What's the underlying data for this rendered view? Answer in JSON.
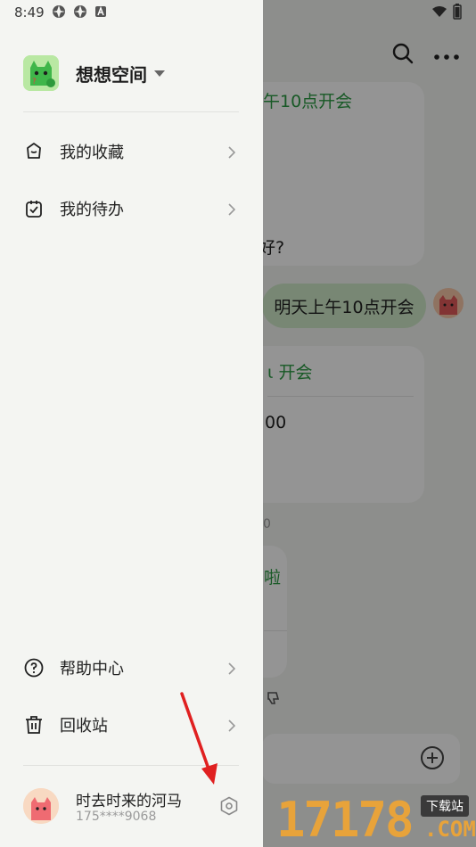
{
  "status_bar": {
    "time": "8:49"
  },
  "drawer": {
    "space_name": "想想空间",
    "menu_top": [
      {
        "label": "我的收藏",
        "icon": "star-icon"
      },
      {
        "label": "我的待办",
        "icon": "todo-icon"
      }
    ],
    "menu_bottom": [
      {
        "label": "帮助中心",
        "icon": "help-icon"
      },
      {
        "label": "回收站",
        "icon": "trash-icon"
      }
    ],
    "user": {
      "name": "时去时来的河马",
      "phone": "175****9068"
    }
  },
  "background_chat": {
    "card1_green": "午10点开会",
    "card1_dark": "好?",
    "bubble_text": "明天上午10点开会",
    "card2_green": "开会",
    "card2_dark": "00",
    "small_num": "0",
    "card3_green": "啦"
  },
  "watermark": {
    "numbers": "17178",
    "badge": "下载站",
    "domain": ".COM"
  },
  "colors": {
    "accent_green": "#2a9a42",
    "bubble": "#cfe9c9",
    "annotation_arrow": "#e02020"
  }
}
